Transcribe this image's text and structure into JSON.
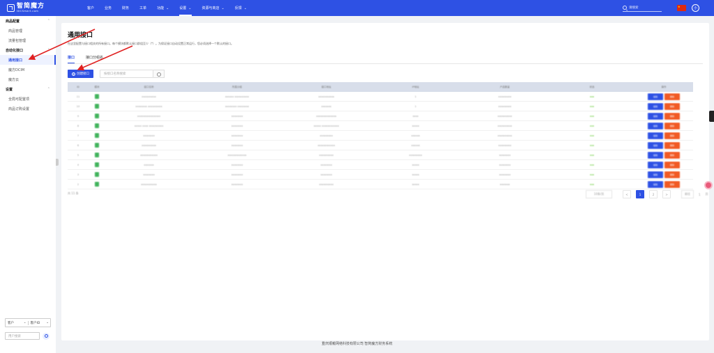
{
  "brand": {
    "name_cn": "智简魔方",
    "name_en": "IDCSmart.com"
  },
  "nav": [
    {
      "label": "客户",
      "has_dropdown": false,
      "active": false
    },
    {
      "label": "业务",
      "has_dropdown": false,
      "active": false
    },
    {
      "label": "财务",
      "has_dropdown": false,
      "active": false
    },
    {
      "label": "工单",
      "has_dropdown": false,
      "active": false
    },
    {
      "label": "功能",
      "has_dropdown": true,
      "active": false
    },
    {
      "label": "设置",
      "has_dropdown": true,
      "active": true
    },
    {
      "label": "资源与商店",
      "has_dropdown": true,
      "active": false
    },
    {
      "label": "反馈",
      "has_dropdown": true,
      "active": false
    }
  ],
  "topbar": {
    "search_placeholder": "请搜索",
    "avatar_initial": "小",
    "colors": {
      "primary": "#2e51e4",
      "danger": "#f15a24",
      "success": "#41b35c"
    }
  },
  "sidebar": {
    "groups": [
      {
        "label": "商品配置",
        "collapsible": true,
        "items": [
          {
            "label": "商品管理",
            "active": false
          },
          {
            "label": "流量包管理",
            "active": false
          }
        ]
      },
      {
        "label": "自动化接口",
        "collapsible": true,
        "items": [
          {
            "label": "通用接口",
            "active": true
          },
          {
            "label": "魔方DCIM",
            "active": false
          },
          {
            "label": "魔方云",
            "active": false
          }
        ]
      },
      {
        "label": "设置",
        "collapsible": true,
        "items": [
          {
            "label": "全局可配置项",
            "active": false
          },
          {
            "label": "商品订购设置",
            "active": false
          }
        ]
      }
    ],
    "filter": {
      "select1": "客户",
      "select2": "客户ID",
      "search_placeholder": "用户搜索"
    }
  },
  "page": {
    "title": "通用接口",
    "description": "在这里配置与接口相关的所有接口。每个模块都默认接口群组至少（*）。为保证接口自动设置正常运行，您必须选择一个默认的接口。",
    "tabs": [
      {
        "label": "接口",
        "active": true
      },
      {
        "label": "接口分组名",
        "active": false
      }
    ],
    "create_button": "创建接口",
    "search_placeholder": "按接口名称搜索"
  },
  "table": {
    "headers": [
      "ID",
      "模块",
      "接口名称",
      "所属分组",
      "接口地址",
      "IP地址",
      "产品数量",
      "状态",
      "操作"
    ],
    "rows": [
      [
        "11",
        "",
        "xxxxxxxxxx",
        "xxxxxx xxxxxxxxxx",
        "xxxxxxxxxxx",
        "1",
        "xxxxxxxxx",
        "xxx",
        ""
      ],
      [
        "10",
        "",
        "xxxxxxxx xxxxxxxxxx",
        "xxxxxxxx xxxxxxxx",
        "xxxxxxx",
        "1",
        "xxxxxxxxx",
        "xxx",
        ""
      ],
      [
        "9",
        "",
        "xxxxxxxxxxxxxxxx",
        "xxxxxxxx",
        "xxxxxxxxxxxxxx",
        "xxxx",
        "xxxxxxxxxx",
        "xxx",
        ""
      ],
      [
        "8",
        "",
        "xxxxx xxxx xxxxxxxxxx",
        "xxxxxxxx",
        "xxxxx xxxxxxxxxxxx",
        "xxxxx",
        "xxxxxxxxxx",
        "xxx",
        ""
      ],
      [
        "7",
        "",
        "xxxxxxxx",
        "xxxxxxxx",
        "xxxxxxxxx",
        "xxxxxx",
        "xxxxxxxxxx",
        "xxx",
        ""
      ],
      [
        "6",
        "",
        "xxxxxxxxxx",
        "xxxxxxxx",
        "xxxxxxxxxxxx",
        "xxxxxx",
        "xxxxxxxxx",
        "xxx",
        ""
      ],
      [
        "5",
        "",
        "xxxxxxxxxxxx",
        "xxxxxxxxxxxxx",
        "xxxxxxxxxx",
        "xxxxxxxxx",
        "xxxxxxxx",
        "xxx",
        ""
      ],
      [
        "4",
        "",
        "xxxxxxx",
        "xxxxxxxx",
        "xxxxxxxx",
        "xxxxx",
        "xxxxxxxx",
        "xxx",
        ""
      ],
      [
        "3",
        "",
        "xxxxxxxx",
        "xxxxxxxx",
        "xxxxxxxx",
        "xxxxx",
        "xxxxxxxx",
        "xxx",
        ""
      ],
      [
        "2",
        "",
        "xxxxxxxxxxx",
        "xxxxxxxx",
        "xxxxxxxxxx",
        "xxxxx",
        "xxxxxxx",
        "xxx",
        ""
      ]
    ],
    "edit_label": "编辑",
    "delete_label": "删除"
  },
  "pagination": {
    "total": "共 11 条",
    "page_size": "10条/页",
    "pages": [
      "1",
      "2"
    ],
    "current": "1",
    "prev": "<",
    "next": ">",
    "goto_label": "前往",
    "goto_value": "1",
    "page_unit": "页"
  },
  "footer": "重庆顺戴网络科技有限公司 智简魔方财务系统"
}
